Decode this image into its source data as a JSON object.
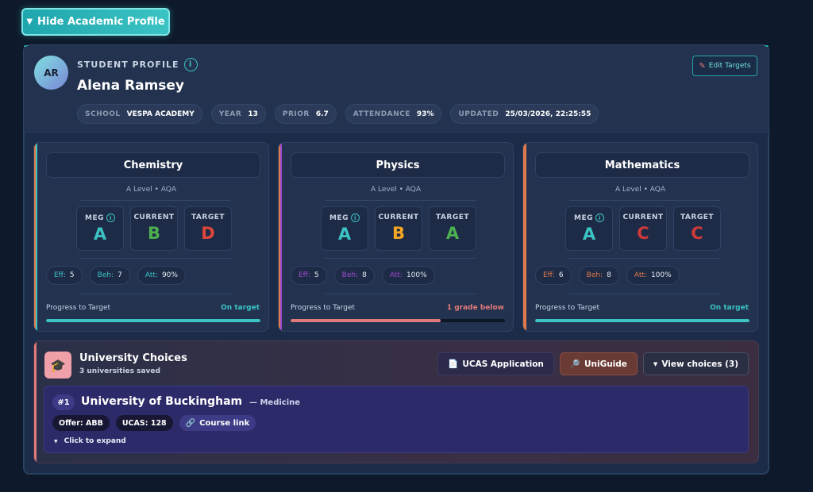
{
  "toggle": {
    "label": "Hide Academic Profile",
    "icon": "caret-down-icon"
  },
  "profile": {
    "initials": "AR",
    "label": "STUDENT PROFILE",
    "info_icon": "i",
    "name": "Alena Ramsey",
    "edit_label": "Edit Targets",
    "chips": [
      {
        "key": "SCHOOL",
        "value": "VESPA ACADEMY"
      },
      {
        "key": "YEAR",
        "value": "13"
      },
      {
        "key": "PRIOR",
        "value": "6.7"
      },
      {
        "key": "ATTENDANCE",
        "value": "93%"
      },
      {
        "key": "UPDATED",
        "value": "25/03/2026, 22:25:55"
      }
    ]
  },
  "grade_labels": {
    "meg": "MEG",
    "current": "CURRENT",
    "target": "TARGET"
  },
  "progress_label": "Progress to Target",
  "subjects": [
    {
      "name": "Chemistry",
      "sub": "A Level • AQA",
      "accent": "#e07a4a",
      "accent2": "#3bc3c4",
      "meg": "A",
      "current": "B",
      "target": "D",
      "meg_color": "#3cc3c3",
      "current_color": "#4caf50",
      "target_color": "#e0463c",
      "eff_label": "Eff:",
      "eff": "5",
      "beh_label": "Beh:",
      "beh": "7",
      "att_label": "Att:",
      "att": "90%",
      "stat_color": "#3cc3c3",
      "status": "On target",
      "status_color": "#3cc3c3",
      "progress": 1.0,
      "bar_color": "#3cc3c3"
    },
    {
      "name": "Physics",
      "sub": "A Level • AQA",
      "accent": "#e07a4a",
      "accent2": "#a04ad0",
      "meg": "A",
      "current": "B",
      "target": "A",
      "meg_color": "#3cc3c3",
      "current_color": "#f5a623",
      "target_color": "#4caf50",
      "eff_label": "Eff:",
      "eff": "5",
      "beh_label": "Beh:",
      "beh": "8",
      "att_label": "Att:",
      "att": "100%",
      "stat_color": "#a04ad0",
      "status": "1 grade below",
      "status_color": "#e07a7a",
      "progress": 0.7,
      "bar_color": "#e07a7a"
    },
    {
      "name": "Mathematics",
      "sub": "A Level • AQA",
      "accent": "#e07a4a",
      "accent2": "#e07a4a",
      "meg": "A",
      "current": "C",
      "target": "C",
      "meg_color": "#3cc3c3",
      "current_color": "#d03a3a",
      "target_color": "#d03a3a",
      "eff_label": "Eff:",
      "eff": "6",
      "beh_label": "Beh:",
      "beh": "8",
      "att_label": "Att:",
      "att": "100%",
      "stat_color": "#e07a4a",
      "status": "On target",
      "status_color": "#3cc3c3",
      "progress": 1.0,
      "bar_color": "#3cc3c3"
    }
  ],
  "universities": {
    "title": "University Choices",
    "subtitle": "3 universities saved",
    "ucas_label": "UCAS Application",
    "uniguide_label": "UniGuide",
    "view_label": "View choices (3)",
    "first": {
      "rank": "#1",
      "name": "University of Buckingham",
      "course": "— Medicine",
      "offer": "Offer: ABB",
      "ucas": "UCAS: 128",
      "link": "Course link",
      "expand": "Click to expand"
    }
  }
}
